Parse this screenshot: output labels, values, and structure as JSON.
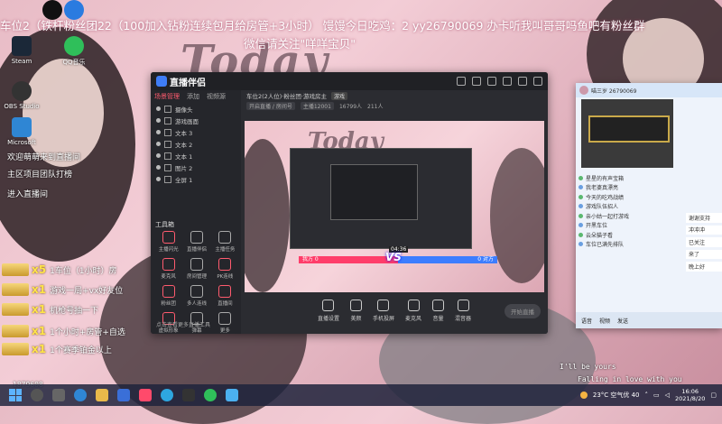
{
  "banner": {
    "line1": "车位2（铁杆粉丝团22（100加入钻粉连续包月给房管+3小时） 馒馒今日吃鸡：2 yy26790069 办卡听我叫哥哥吗鱼吧有粉丝群",
    "line2": "微信请关注\"咩咩宝贝\""
  },
  "background": {
    "title": "Today",
    "bottom_text1": "I'll be yours",
    "bottom_text2": "Falling in love with you",
    "corner_id": "1879608"
  },
  "desktop_icons": [
    {
      "label": "Steam",
      "icon": "steam-icon"
    },
    {
      "label": "OBS Studio",
      "icon": "obs-icon"
    },
    {
      "label": "Microsoft",
      "icon": "edge-icon"
    },
    {
      "label": "QQ音乐",
      "icon": "qq-music-icon"
    }
  ],
  "chat_overlay": {
    "welcome": "欢迎萌萌来到直播间",
    "line2": "主区项目团队打榜",
    "line3": "进入直播间",
    "gifts": [
      {
        "count": "x5",
        "text": "1车位（1小时）房"
      },
      {
        "count": "x1",
        "text": "游戏一局+vx好友位"
      },
      {
        "count": "x1",
        "text": "机枪号抽一下"
      },
      {
        "count": "x1",
        "text": "1个小时+房管+自选"
      },
      {
        "count": "x1",
        "text": "1个赛季铂金以上"
      }
    ]
  },
  "app": {
    "name": "直播伴侣",
    "tabs": [
      "场景管理",
      "添加",
      "视频源"
    ],
    "scenes": [
      "摄像头",
      "游戏画面",
      "文本 3",
      "文本 2",
      "文本 1",
      "图片 2",
      "全屏 1"
    ],
    "tools_title": "工具箱",
    "tools": [
      {
        "label": "主播闪光",
        "icon": "flash-icon"
      },
      {
        "label": "直播伴侣",
        "icon": "bot-icon"
      },
      {
        "label": "主播任务",
        "icon": "task-icon"
      },
      {
        "label": "麦克风",
        "icon": "mic-icon"
      },
      {
        "label": "房间管理",
        "icon": "room-icon"
      },
      {
        "label": "PK连线",
        "icon": "pk-icon"
      },
      {
        "label": "粉丝团",
        "icon": "fans-icon"
      },
      {
        "label": "多人连线",
        "icon": "multi-icon"
      },
      {
        "label": "直播间",
        "icon": "live-icon"
      },
      {
        "label": "虚拟形象",
        "icon": "avatar-icon"
      },
      {
        "label": "弹幕",
        "icon": "danmaku-icon"
      },
      {
        "label": "更多",
        "icon": "more-icon"
      }
    ],
    "footer": "点击查看更多直播工具",
    "stream_title": "车位2(2人位)·粉丝团·游戏房主",
    "stream_tag": "游戏",
    "stats": [
      "开启直播 / 房间号",
      "主播12001",
      "16799人",
      "211人"
    ],
    "pk": {
      "left": "我方 0",
      "right": "0 对方",
      "time": "04:36",
      "vs": "VS"
    },
    "preview_title": "Today",
    "controls": [
      "直播设置",
      "美颜",
      "手机投屏",
      "麦克风",
      "音量",
      "混音器"
    ],
    "start_label": "开始直播"
  },
  "chatwin": {
    "title": "喵三岁 26790069",
    "messages": [
      "星星的有声宝箱",
      "我老婆真漂亮",
      "今天的吃鸡战绩",
      "游戏队伍招人",
      "亲小姑一起打游戏",
      "开黑车位",
      "云朵猫子看",
      "车位已满先排队"
    ],
    "side_msgs": [
      "谢谢支持",
      "冲冲冲",
      "已关注",
      "来了",
      "晚上好"
    ],
    "footer": [
      "语音",
      "视频",
      "发送"
    ]
  },
  "taskbar": {
    "weather": "23°C 空气优 40",
    "time": "16:06",
    "date": "2021/8/20"
  }
}
